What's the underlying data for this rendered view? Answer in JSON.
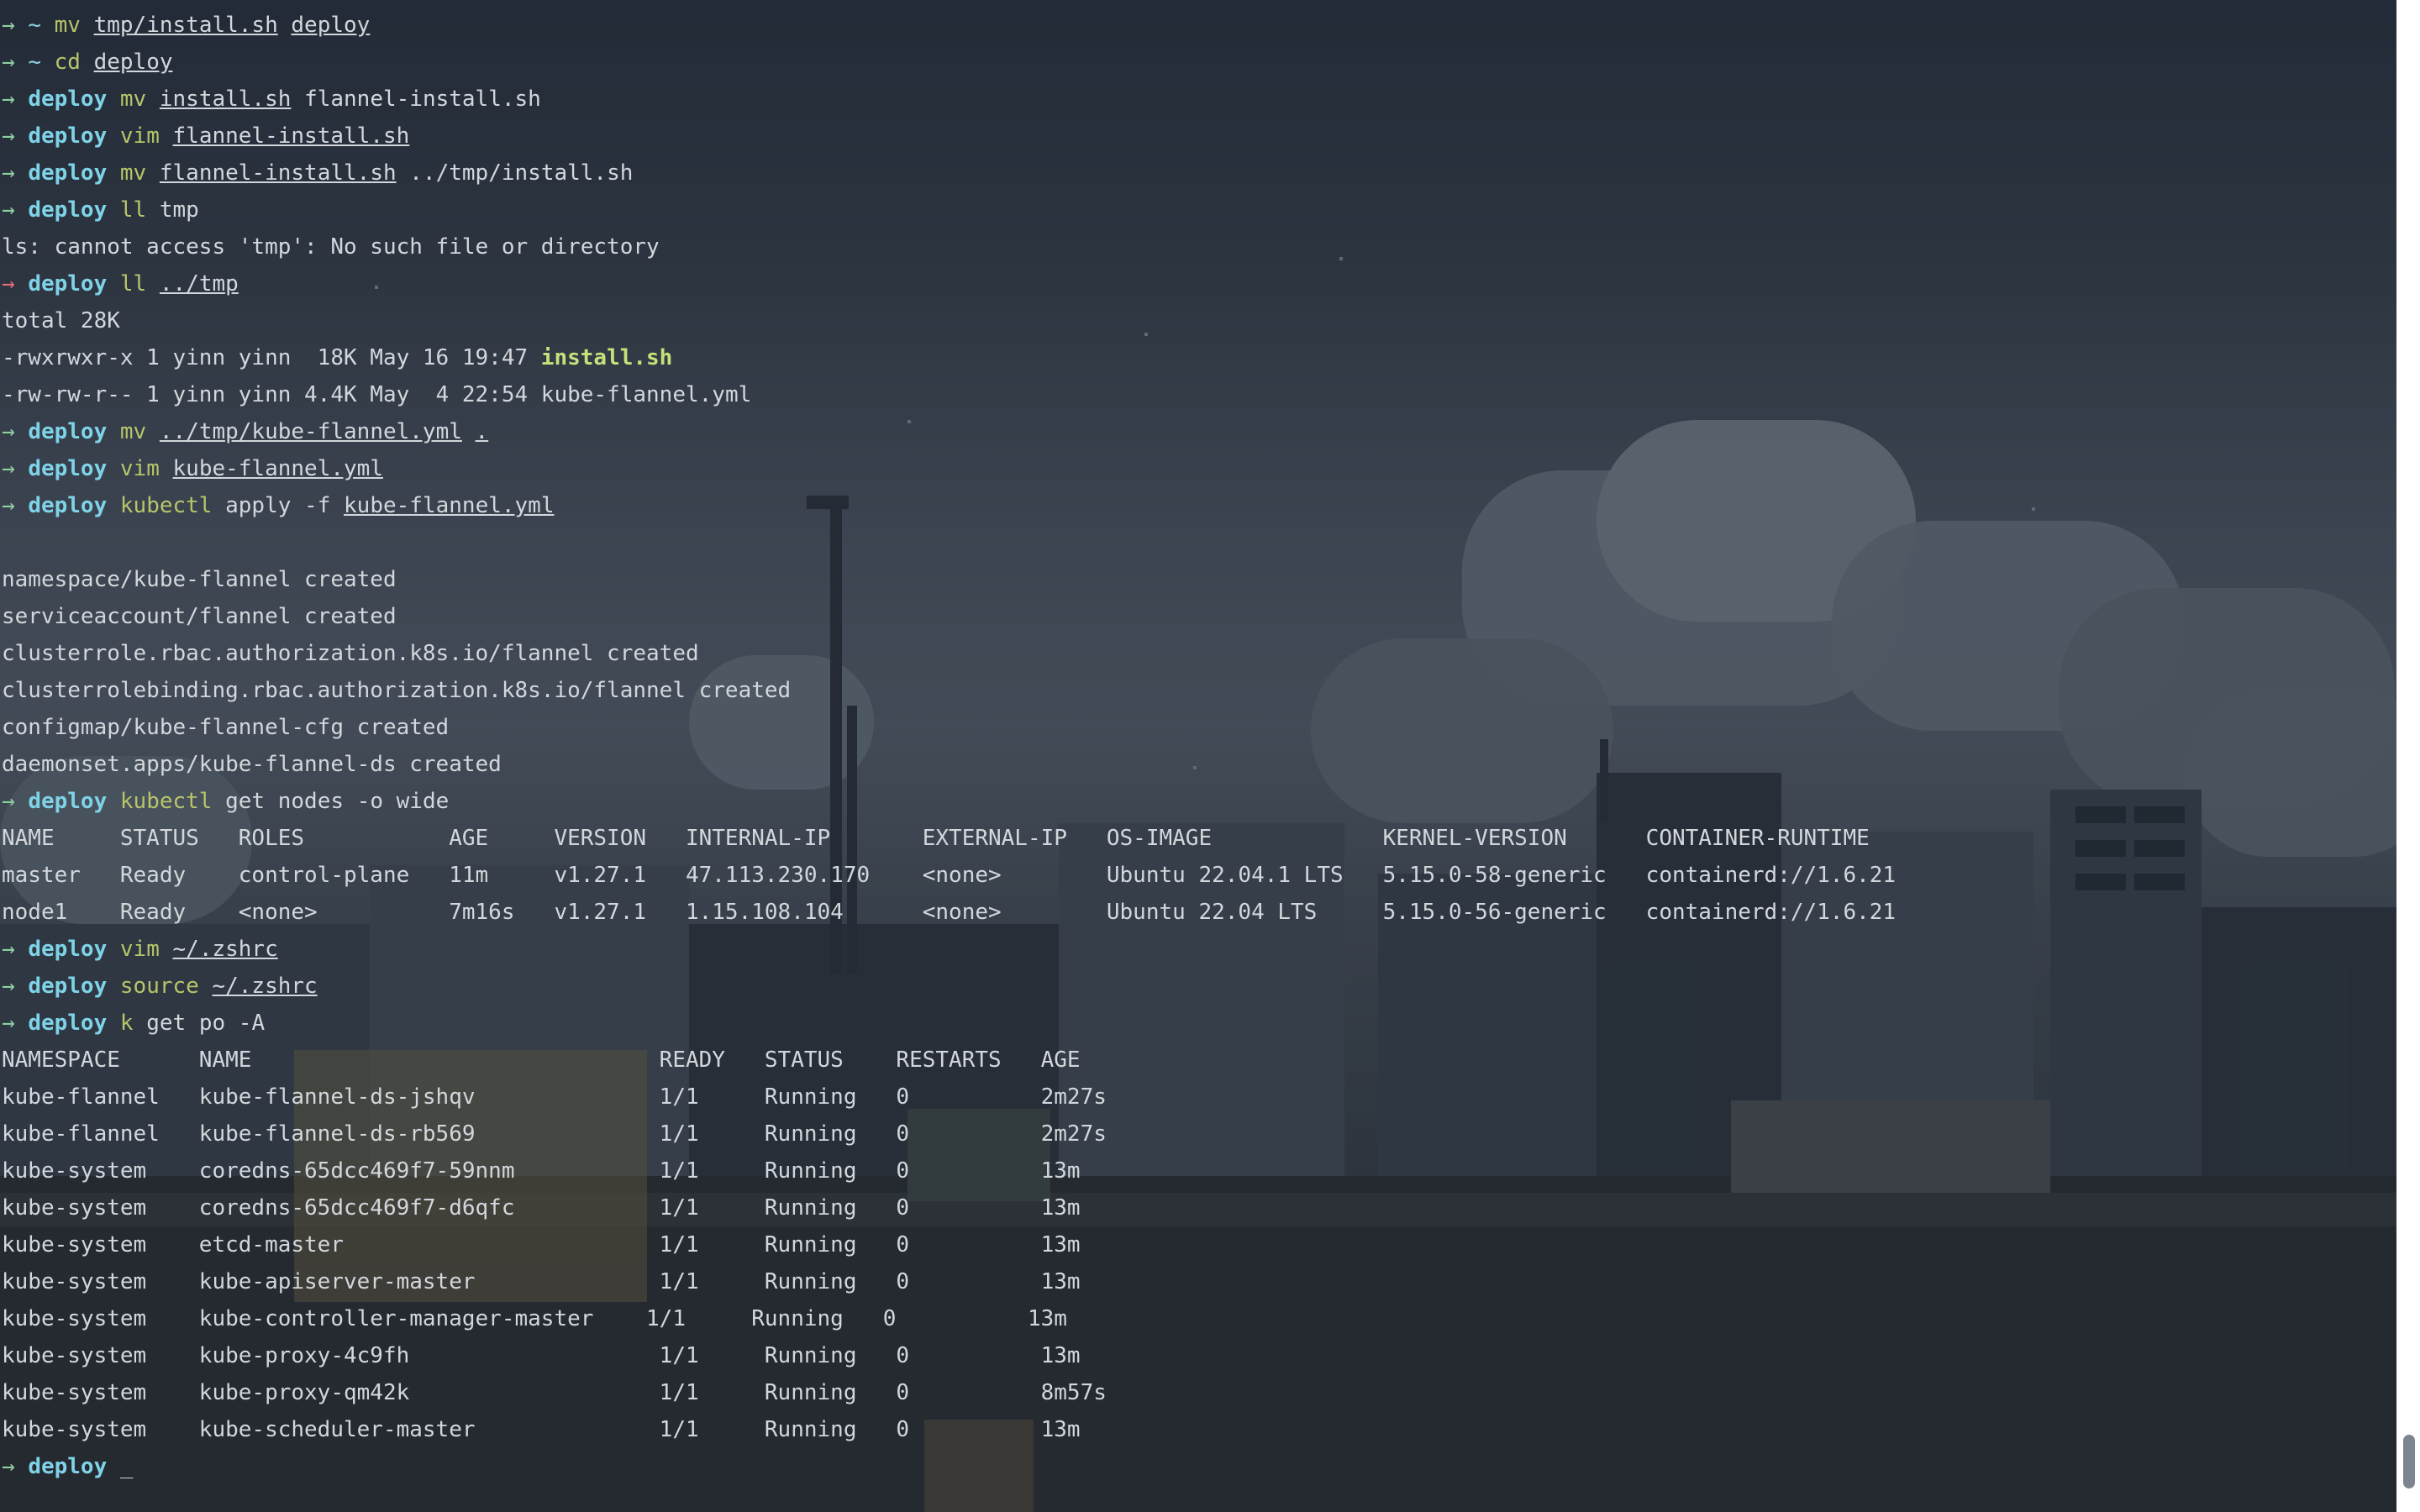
{
  "terminal": {
    "lines": [
      {
        "type": "prompt",
        "arrow": "→",
        "dir": "~",
        "cmd": "mv",
        "args": [
          "tmp/install.sh",
          "deploy"
        ],
        "underline": [
          true,
          true
        ]
      },
      {
        "type": "prompt",
        "arrow": "→",
        "dir": "~",
        "cmd": "cd",
        "args": [
          "deploy"
        ],
        "underline": [
          true
        ]
      },
      {
        "type": "prompt",
        "arrow": "→",
        "dir": "deploy",
        "cmd": "mv",
        "args": [
          "install.sh",
          "flannel-install.sh"
        ],
        "underline": [
          true,
          false
        ]
      },
      {
        "type": "prompt",
        "arrow": "→",
        "dir": "deploy",
        "cmd": "vim",
        "args": [
          "flannel-install.sh"
        ],
        "underline": [
          true
        ]
      },
      {
        "type": "prompt",
        "arrow": "→",
        "dir": "deploy",
        "cmd": "mv",
        "args": [
          "flannel-install.sh",
          "../tmp/install.sh"
        ],
        "underline": [
          true,
          false
        ]
      },
      {
        "type": "prompt",
        "arrow": "→",
        "dir": "deploy",
        "cmd": "ll",
        "args": [
          "tmp"
        ],
        "underline": [
          false
        ]
      },
      {
        "type": "output",
        "text": "ls: cannot access 'tmp': No such file or directory"
      },
      {
        "type": "prompt",
        "arrow": "→",
        "error": true,
        "dir": "deploy",
        "cmd": "ll",
        "args": [
          "../tmp"
        ],
        "underline": [
          true
        ]
      },
      {
        "type": "output",
        "text": "total 28K"
      },
      {
        "type": "lsline",
        "prefix": "-rwxrwxr-x 1 yinn yinn  18K May 16 19:47 ",
        "name": "install.sh",
        "exec": true
      },
      {
        "type": "lsline",
        "prefix": "-rw-rw-r-- 1 yinn yinn 4.4K May  4 22:54 ",
        "name": "kube-flannel.yml",
        "exec": false
      },
      {
        "type": "prompt",
        "arrow": "→",
        "dir": "deploy",
        "cmd": "mv",
        "args": [
          "../tmp/kube-flannel.yml",
          "."
        ],
        "underline": [
          true,
          true
        ]
      },
      {
        "type": "prompt",
        "arrow": "→",
        "dir": "deploy",
        "cmd": "vim",
        "args": [
          "kube-flannel.yml"
        ],
        "underline": [
          true
        ]
      },
      {
        "type": "prompt",
        "arrow": "→",
        "dir": "deploy",
        "cmd": "kubectl",
        "args": [
          "apply",
          "-f",
          "kube-flannel.yml"
        ],
        "underline": [
          false,
          false,
          true
        ]
      },
      {
        "type": "output",
        "text": ""
      },
      {
        "type": "output",
        "text": "namespace/kube-flannel created"
      },
      {
        "type": "output",
        "text": "serviceaccount/flannel created"
      },
      {
        "type": "output",
        "text": "clusterrole.rbac.authorization.k8s.io/flannel created"
      },
      {
        "type": "output",
        "text": "clusterrolebinding.rbac.authorization.k8s.io/flannel created"
      },
      {
        "type": "output",
        "text": "configmap/kube-flannel-cfg created"
      },
      {
        "type": "output",
        "text": "daemonset.apps/kube-flannel-ds created"
      },
      {
        "type": "prompt",
        "arrow": "→",
        "dir": "deploy",
        "cmd": "kubectl",
        "args": [
          "get",
          "nodes",
          "-o",
          "wide"
        ],
        "underline": [
          false,
          false,
          false,
          false
        ]
      },
      {
        "type": "output",
        "text": "NAME     STATUS   ROLES           AGE     VERSION   INTERNAL-IP       EXTERNAL-IP   OS-IMAGE             KERNEL-VERSION      CONTAINER-RUNTIME"
      },
      {
        "type": "output",
        "text": "master   Ready    control-plane   11m     v1.27.1   47.113.230.170    <none>        Ubuntu 22.04.1 LTS   5.15.0-58-generic   containerd://1.6.21"
      },
      {
        "type": "output",
        "text": "node1    Ready    <none>          7m16s   v1.27.1   1.15.108.104      <none>        Ubuntu 22.04 LTS     5.15.0-56-generic   containerd://1.6.21"
      },
      {
        "type": "prompt",
        "arrow": "→",
        "dir": "deploy",
        "cmd": "vim",
        "args": [
          "~/.zshrc"
        ],
        "underline": [
          true
        ]
      },
      {
        "type": "prompt",
        "arrow": "→",
        "dir": "deploy",
        "cmd": "source",
        "args": [
          "~/.zshrc"
        ],
        "underline": [
          true
        ]
      },
      {
        "type": "prompt",
        "arrow": "→",
        "dir": "deploy",
        "cmd": "k",
        "args": [
          "get",
          "po",
          "-A"
        ],
        "underline": [
          false,
          false,
          false
        ]
      },
      {
        "type": "output",
        "text": "NAMESPACE      NAME                               READY   STATUS    RESTARTS   AGE"
      },
      {
        "type": "output",
        "text": "kube-flannel   kube-flannel-ds-jshqv              1/1     Running   0          2m27s"
      },
      {
        "type": "output",
        "text": "kube-flannel   kube-flannel-ds-rb569              1/1     Running   0          2m27s"
      },
      {
        "type": "output",
        "text": "kube-system    coredns-65dcc469f7-59nnm           1/1     Running   0          13m"
      },
      {
        "type": "output",
        "text": "kube-system    coredns-65dcc469f7-d6qfc           1/1     Running   0          13m"
      },
      {
        "type": "output",
        "text": "kube-system    etcd-master                        1/1     Running   0          13m"
      },
      {
        "type": "output",
        "text": "kube-system    kube-apiserver-master              1/1     Running   0          13m"
      },
      {
        "type": "output",
        "text": "kube-system    kube-controller-manager-master    1/1     Running   0          13m"
      },
      {
        "type": "output",
        "text": "kube-system    kube-proxy-4c9fh                   1/1     Running   0          13m"
      },
      {
        "type": "output",
        "text": "kube-system    kube-proxy-qm42k                   1/1     Running   0          8m57s"
      },
      {
        "type": "output",
        "text": "kube-system    kube-scheduler-master              1/1     Running   0          13m"
      },
      {
        "type": "prompt",
        "arrow": "→",
        "dir": "deploy",
        "cmd": "",
        "args": [],
        "underline": [],
        "cursor": "_"
      }
    ]
  },
  "colors": {
    "prompt_arrow": "#8ecfa0",
    "prompt_arrow_error": "#e06c75",
    "cwd": "#7fd3e8",
    "command": "#b7c46a",
    "executable": "#c6e07a",
    "text": "#d3d7dc"
  },
  "icons": {
    "scrollbar": "scrollbar-thumb"
  }
}
